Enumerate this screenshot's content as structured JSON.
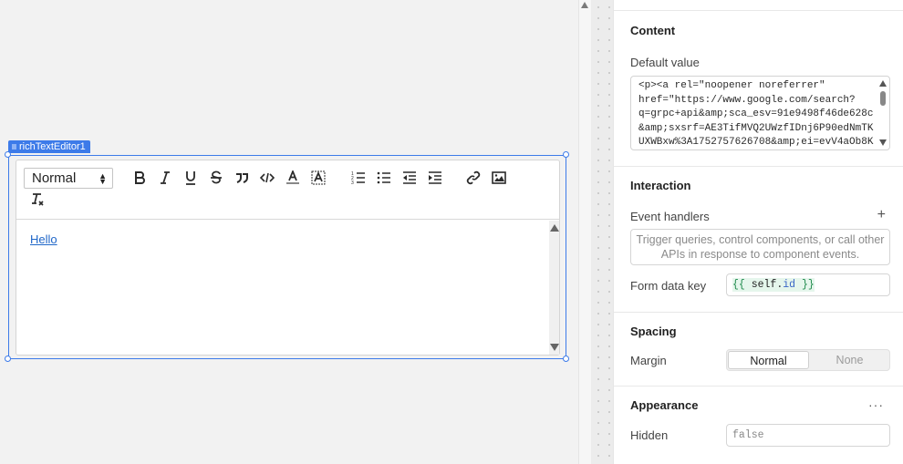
{
  "component": {
    "name": "richTextEditor1"
  },
  "editor": {
    "format_select": "Normal",
    "content_link": "Hello"
  },
  "panel": {
    "content": {
      "title": "Content",
      "default_value_label": "Default value",
      "default_value_lines": [
        "<p><a rel=\"noopener noreferrer\"",
        "href=\"https://www.google.com/search?",
        "q=grpc+api&amp;sca_esv=91e9498f46de628c",
        "&amp;sxsrf=AE3TifMVQ2UWzfIDnj6P90edNmTK",
        "UXWBxw%3A1752757626708&amp;ei=evV4aOb8K"
      ]
    },
    "interaction": {
      "title": "Interaction",
      "event_handlers_label": "Event handlers",
      "event_handlers_hint": "Trigger queries, control components, or call other APIs in response to component events.",
      "form_data_key_label": "Form data key",
      "form_data_key_open": "{{ ",
      "form_data_key_obj": "self",
      "form_data_key_dot": ".",
      "form_data_key_prop": "id",
      "form_data_key_close": " }}"
    },
    "spacing": {
      "title": "Spacing",
      "margin_label": "Margin",
      "margin_options": [
        "Normal",
        "None"
      ]
    },
    "appearance": {
      "title": "Appearance",
      "hidden_label": "Hidden",
      "hidden_value": "false",
      "more": "···"
    }
  },
  "colors": {
    "accent": "#3d7be9",
    "link": "#2067c8"
  }
}
